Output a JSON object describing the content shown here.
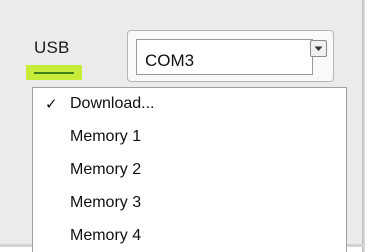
{
  "port": {
    "label": "USB",
    "indicator_color": "#c8ec3a",
    "indicator_line_color": "#3f7f1e"
  },
  "combo": {
    "selected": "COM3",
    "arrow_icon": "chevron-down-icon"
  },
  "menu": {
    "items": [
      {
        "label": "Download...",
        "checked": true
      },
      {
        "label": "Memory 1",
        "checked": false
      },
      {
        "label": "Memory 2",
        "checked": false
      },
      {
        "label": "Memory 3",
        "checked": false
      },
      {
        "label": "Memory 4",
        "checked": false
      }
    ],
    "check_glyph": "✓"
  }
}
